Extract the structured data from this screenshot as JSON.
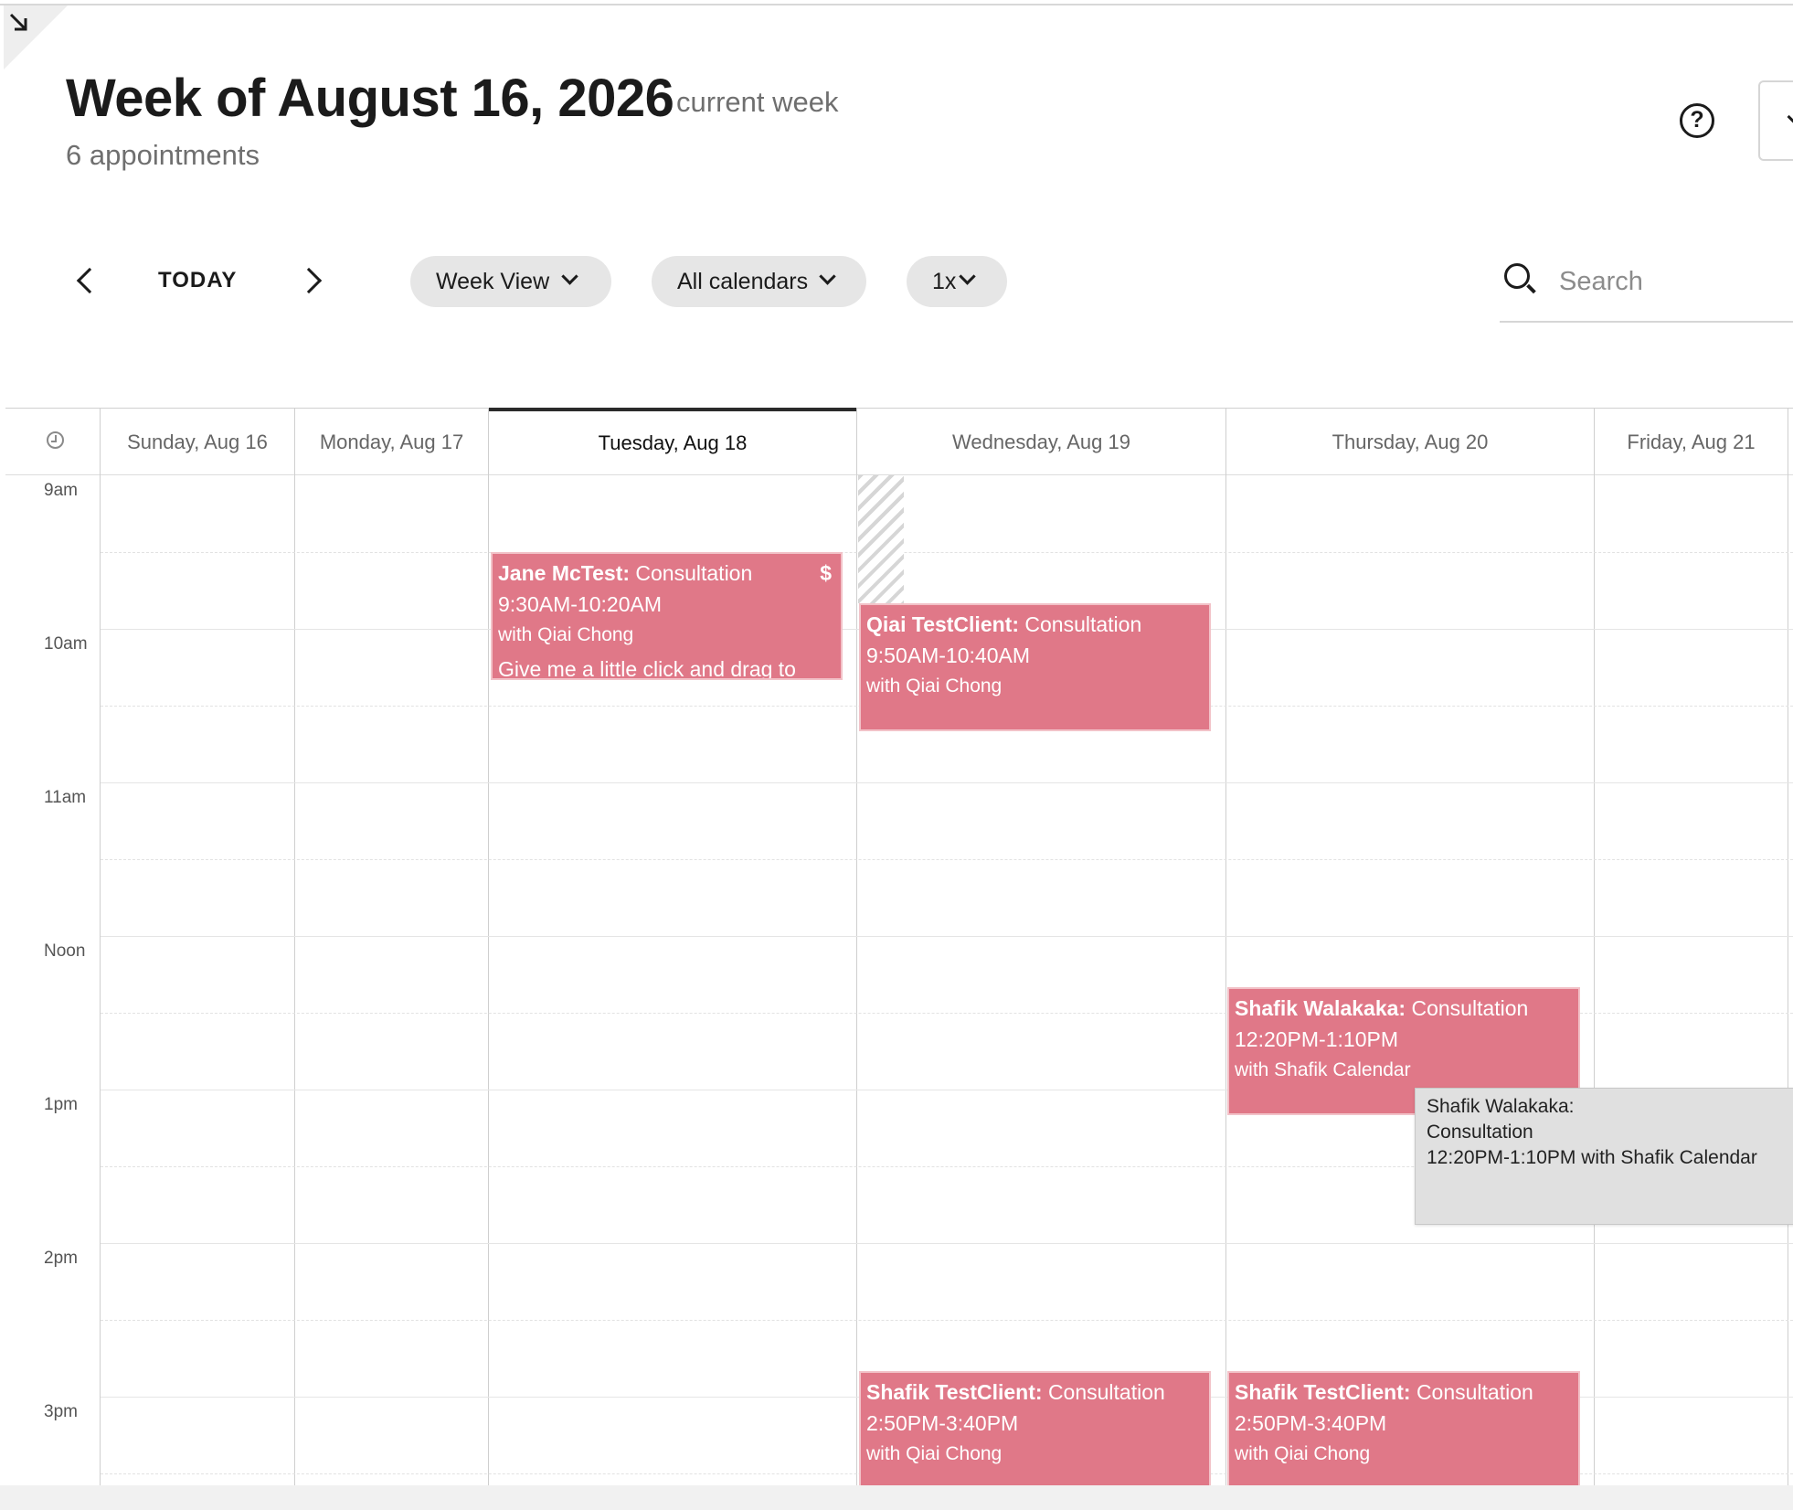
{
  "header": {
    "title": "Week of August 16, 2026",
    "subtitle": "current week",
    "count": "6 appointments",
    "help_symbol": "?",
    "icons": {
      "corner": "arrow-collapse-icon",
      "help": "question-circle-icon",
      "search": "search-icon",
      "clock": "clock-icon"
    }
  },
  "toolbar": {
    "today": "TODAY",
    "view_pill": "Week View",
    "calendars_pill": "All calendars",
    "zoom_pill": "1x",
    "search_placeholder": "Search"
  },
  "days": [
    "Sunday, Aug 16",
    "Monday, Aug 17",
    "Tuesday, Aug 18",
    "Wednesday, Aug 19",
    "Thursday, Aug 20",
    "Friday, Aug 21"
  ],
  "active_day": "Tuesday, Aug 18",
  "hours": [
    "9am",
    "10am",
    "11am",
    "Noon",
    "1pm",
    "2pm",
    "3pm"
  ],
  "appointments": [
    {
      "client": "Jane McTest:",
      "type": "Consultation",
      "time": "9:30AM-10:20AM",
      "staff": "with Qiai Chong",
      "note": "Give me a little click and drag to",
      "paid": "$"
    },
    {
      "client": "Qiai TestClient:",
      "type": "Consultation",
      "time": "9:50AM-10:40AM",
      "staff": "with Qiai Chong"
    },
    {
      "client": "Shafik Walakaka:",
      "type": "Consultation",
      "time": "12:20PM-1:10PM",
      "staff": "with Shafik Calendar"
    },
    {
      "client": "Shafik TestClient:",
      "type": "Consultation",
      "time": "2:50PM-3:40PM",
      "staff": "with Qiai Chong"
    },
    {
      "client": "Shafik TestClient:",
      "type": "Consultation",
      "time": "2:50PM-3:40PM",
      "staff": "with Qiai Chong"
    }
  ],
  "tooltip": {
    "line1": "Shafik Walakaka:",
    "line2": "Consultation",
    "line3": "12:20PM-1:10PM with Shafik Calendar"
  },
  "colors": {
    "appointment": "#e07888",
    "appointment_border": "#f2c2c8",
    "pill_bg": "#e6e6e6",
    "tooltip_bg": "#e0e0e0"
  }
}
